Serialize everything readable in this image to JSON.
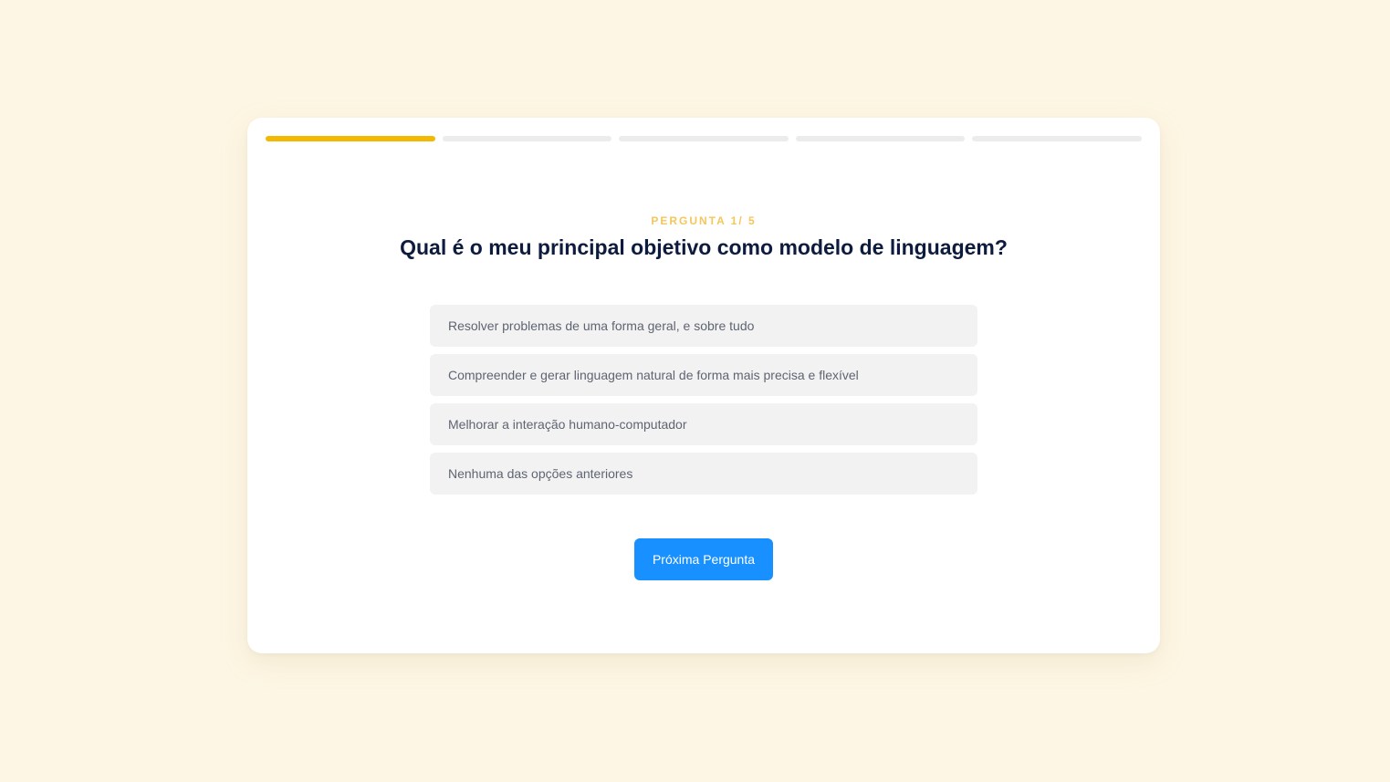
{
  "quiz": {
    "progress": {
      "total_steps": 5,
      "current_step": 1,
      "active_color": "#f5b800",
      "inactive_color": "#ececec"
    },
    "counter_label": "PERGUNTA 1/ 5",
    "question": "Qual é o meu principal objetivo como modelo de linguagem?",
    "options": [
      {
        "label": "Resolver problemas de uma forma geral, e sobre tudo"
      },
      {
        "label": "Compreender e gerar linguagem natural de forma mais precisa e flexível"
      },
      {
        "label": "Melhorar a interação humano-computador"
      },
      {
        "label": "Nenhuma das opções anteriores"
      }
    ],
    "next_button_label": "Próxima Pergunta",
    "accent_color": "#1890ff"
  }
}
